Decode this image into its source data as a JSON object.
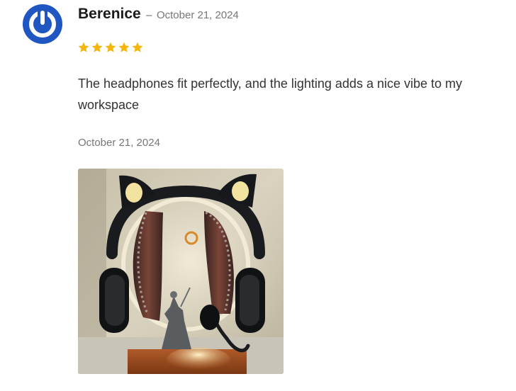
{
  "review": {
    "author": "Berenice",
    "separator": "–",
    "meta_date": "October 21, 2024",
    "rating": 5,
    "rating_max": 5,
    "text": "The headphones fit perfectly, and the lighting adds a nice vibe to my workspace",
    "date": "October 21, 2024",
    "avatar_icon": "power-icon",
    "star_icon": "star-icon"
  },
  "colors": {
    "avatar": "#1f56c2",
    "star": "#f5b50a",
    "text": "#333333",
    "muted": "#777777"
  }
}
